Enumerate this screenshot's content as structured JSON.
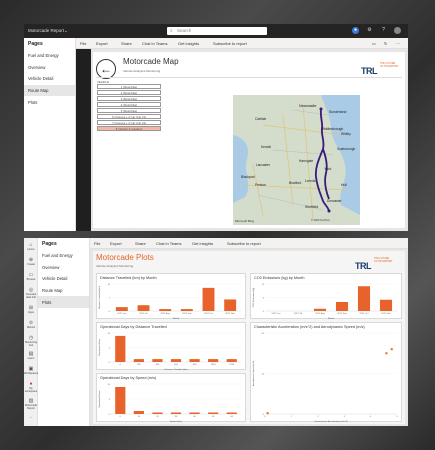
{
  "app": {
    "title": "Motorcade Report",
    "search_placeholder": "Search"
  },
  "shot1": {
    "pages_title": "Pages",
    "pages": [
      "Fuel and Energy",
      "Overview",
      "Vehicle Detail",
      "Route Map",
      "Plots"
    ],
    "selected_page": "Route Map",
    "commands": {
      "file": "File",
      "export": "Export",
      "share": "Share",
      "chat": "Chat in Teams",
      "insights": "Get insights",
      "subscribe": "Subscribe to report"
    },
    "report_title": "Motorcade Map",
    "report_subtitle": "Vehicle Analytics Monitoring",
    "vehicle_header": "VEHICLE",
    "vehicles": [
      "1 (Motorbike)",
      "2 (Motorbike)",
      "3 (Motorbike)",
      "4 (Motorbike)",
      "5 (Motorbike)",
      "6 (Camera + 2 Car Unit V1)",
      "7 (Camera + 2 Car Unit V2)",
      "8 (Vehicle & Gas/Ext)"
    ],
    "selected_vehicle_index": 7,
    "map_places": [
      "Newcastle",
      "Sunderland",
      "Middlesbrough",
      "Whitby",
      "Scarborough",
      "York",
      "Leeds",
      "Bradford",
      "Hull",
      "Kendal",
      "Lancaster",
      "Blackpool",
      "Preston",
      "Harrogate",
      "Sheffield",
      "Doncaster",
      "Carlisle"
    ],
    "map_attribution": "Microsoft Bing",
    "map_copyright": "© 2023 TomTom"
  },
  "shot2": {
    "rail": [
      "Home",
      "Create",
      "Browse",
      "OneLake data hub",
      "Apps",
      "Metrics",
      "Monitoring hub",
      "Learn",
      "Workspaces",
      "My workspace",
      "Motorcade Report"
    ],
    "pages_title": "Pages",
    "pages": [
      "Fuel and Energy",
      "Overview",
      "Vehicle Detail",
      "Route Map",
      "Plots"
    ],
    "selected_page": "Plots",
    "commands": {
      "file": "File",
      "export": "Export",
      "share": "Share",
      "chat": "Chat in Teams",
      "insights": "Get insights",
      "subscribe": "Subscribe to report"
    },
    "report_title": "Motorcade Plots",
    "report_subtitle": "Vehicle Analytics Monitoring"
  },
  "brand": {
    "logo": "TRL",
    "tagline_1": "THE FUTURE",
    "tagline_2": "OF TRANSPORT",
    "accent": "#e8632b",
    "navy": "#1e3c6e"
  },
  "chart_data": [
    {
      "type": "bar",
      "title": "Distance Travelled (km) by Month",
      "xlabel": "Month",
      "ylabel": "Distance Travelled (km)",
      "categories": [
        "2021 Jun",
        "2021 Jul",
        "2021 Aug",
        "2021 Sep",
        "2021 Oct",
        "2021 Nov"
      ],
      "values": [
        2,
        3,
        1,
        1,
        12,
        6
      ],
      "ylim": [
        0,
        14
      ],
      "color": "#e8632b"
    },
    {
      "type": "bar",
      "title": "CO2 Emissions (kg) by Month",
      "xlabel": "Month",
      "ylabel": "CO2 Emissions (kg)",
      "categories": [
        "2021 Jun",
        "2021 Jul",
        "2021 Aug",
        "2021 Sep",
        "2021 Oct",
        "2021 Nov"
      ],
      "values": [
        0,
        0,
        1,
        4,
        11,
        5
      ],
      "ylim": [
        0,
        12
      ],
      "color": "#e8632b"
    },
    {
      "type": "bar",
      "title": "Operational Days by Distance Travelled",
      "xlabel": "Distance Travelled (km)",
      "ylabel": "Operational Days",
      "categories": [
        "0",
        "200",
        "400",
        "600",
        "800",
        "1000",
        "1200"
      ],
      "values": [
        9,
        1,
        1,
        1,
        1,
        1,
        1
      ],
      "ylim": [
        0,
        10
      ],
      "color": "#e8632b"
    },
    {
      "type": "scatter",
      "title": "Characteristic Acceleration (m/s^2) and Aerodynamic Speed (m/s)",
      "xlabel": "Characteristic Acceleration (m/s^2)",
      "ylabel": "Aerodynamic Speed (m/s)",
      "points": [
        [
          0.1,
          0.2
        ],
        [
          4.6,
          15
        ],
        [
          4.8,
          16
        ]
      ],
      "xlim": [
        0,
        5
      ],
      "ylim": [
        0,
        20
      ],
      "color": "#e8632b"
    },
    {
      "type": "bar",
      "title": "Operational Days by Speed (m/s)",
      "xlabel": "Speed (m/s)",
      "ylabel": "Operational Days",
      "categories": [
        "0",
        "10",
        "20",
        "30",
        "40",
        "50",
        "60"
      ],
      "values": [
        9,
        1,
        0.5,
        0.5,
        0.5,
        0.5,
        0.5
      ],
      "ylim": [
        0,
        10
      ],
      "color": "#e8632b"
    }
  ]
}
